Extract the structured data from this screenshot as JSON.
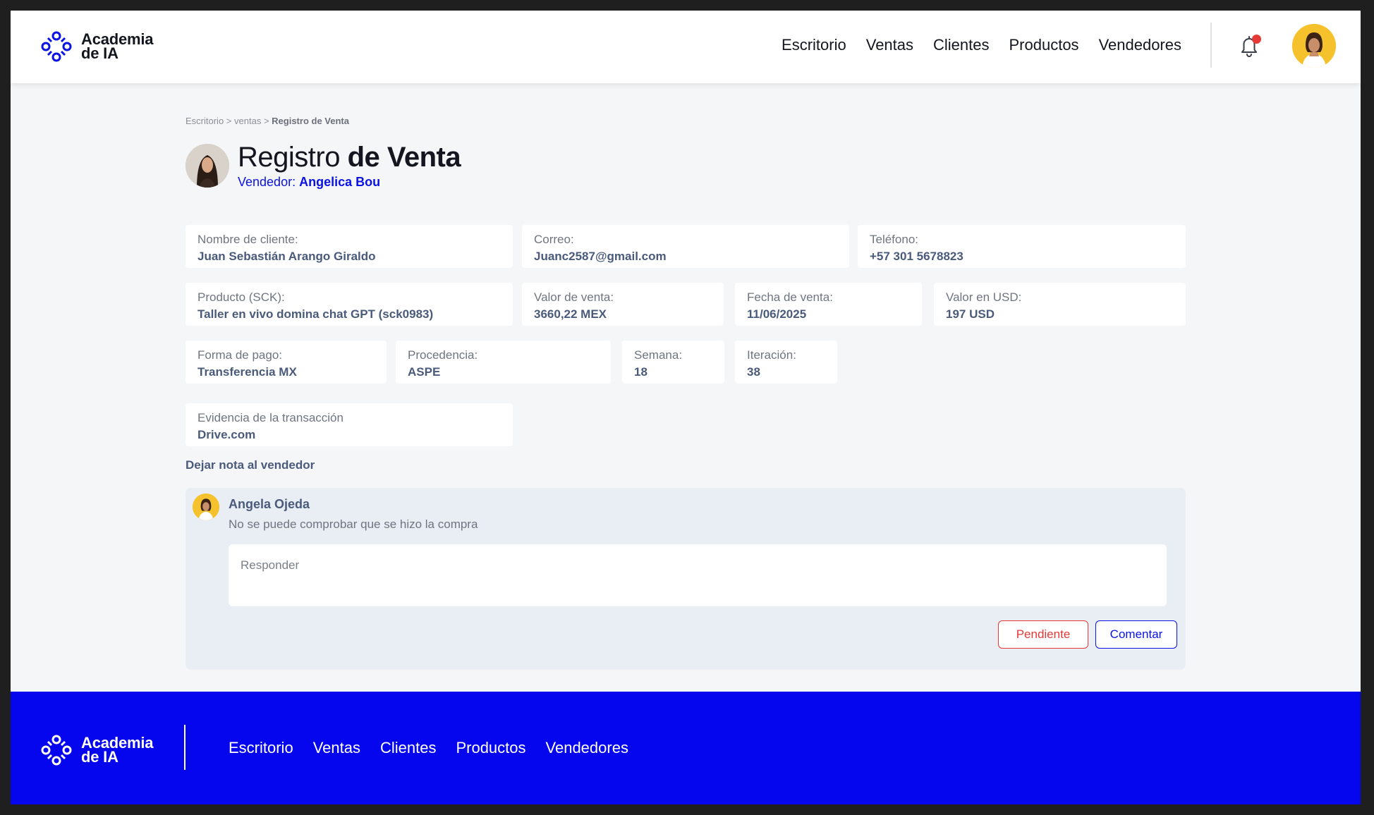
{
  "brand": {
    "line1": "Academia",
    "line2": "de IA"
  },
  "nav": [
    "Escritorio",
    "Ventas",
    "Clientes",
    "Productos",
    "Vendedores"
  ],
  "breadcrumb": {
    "c1": "Escritorio",
    "sep1": " > ",
    "c2": "ventas",
    "sep2": " > ",
    "current": "Registro de Venta"
  },
  "page": {
    "title_light": "Registro",
    "title_bold": "de Venta",
    "vendor_label": "Vendedor:",
    "vendor_name": "Angelica Bou"
  },
  "fields": {
    "cliente": {
      "label": "Nombre  de cliente:",
      "value": "Juan Sebastián Arango Giraldo"
    },
    "correo": {
      "label": "Correo:",
      "value": "Juanc2587@gmail.com"
    },
    "telefono": {
      "label": "Teléfono:",
      "value": "+57 301 5678823"
    },
    "producto": {
      "label": "Producto (SCK):",
      "value": "Taller en vivo domina chat GPT (sck0983)"
    },
    "valor_venta": {
      "label": "Valor de venta:",
      "value": "3660,22 MEX"
    },
    "fecha_venta": {
      "label": "Fecha de venta:",
      "value": "11/06/2025"
    },
    "valor_usd": {
      "label": "Valor en USD:",
      "value": "197 USD"
    },
    "forma_pago": {
      "label": "Forma de pago:",
      "value": "Transferencia MX"
    },
    "procedencia": {
      "label": "Procedencia:",
      "value": "ASPE"
    },
    "semana": {
      "label": "Semana:",
      "value": "18"
    },
    "iteracion": {
      "label": "Iteración:",
      "value": "38"
    },
    "evidencia": {
      "label": "Evidencia de la transacción",
      "value": "Drive.com"
    }
  },
  "note": {
    "heading": "Dejar nota al vendedor",
    "commenter": "Angela Ojeda",
    "comment": "No se puede comprobar que se hizo la compra",
    "reply_placeholder": "Responder",
    "pending_label": "Pendiente",
    "comment_label": "Comentar"
  },
  "colors": {
    "accent": "#0a12e6",
    "footer": "#0505ee",
    "danger": "#e53935",
    "label": "#6f7580",
    "value": "#4a5a7a"
  },
  "icons": {
    "logo": "academia-logo-icon",
    "bell": "bell-icon",
    "notification": "notification-dot"
  }
}
